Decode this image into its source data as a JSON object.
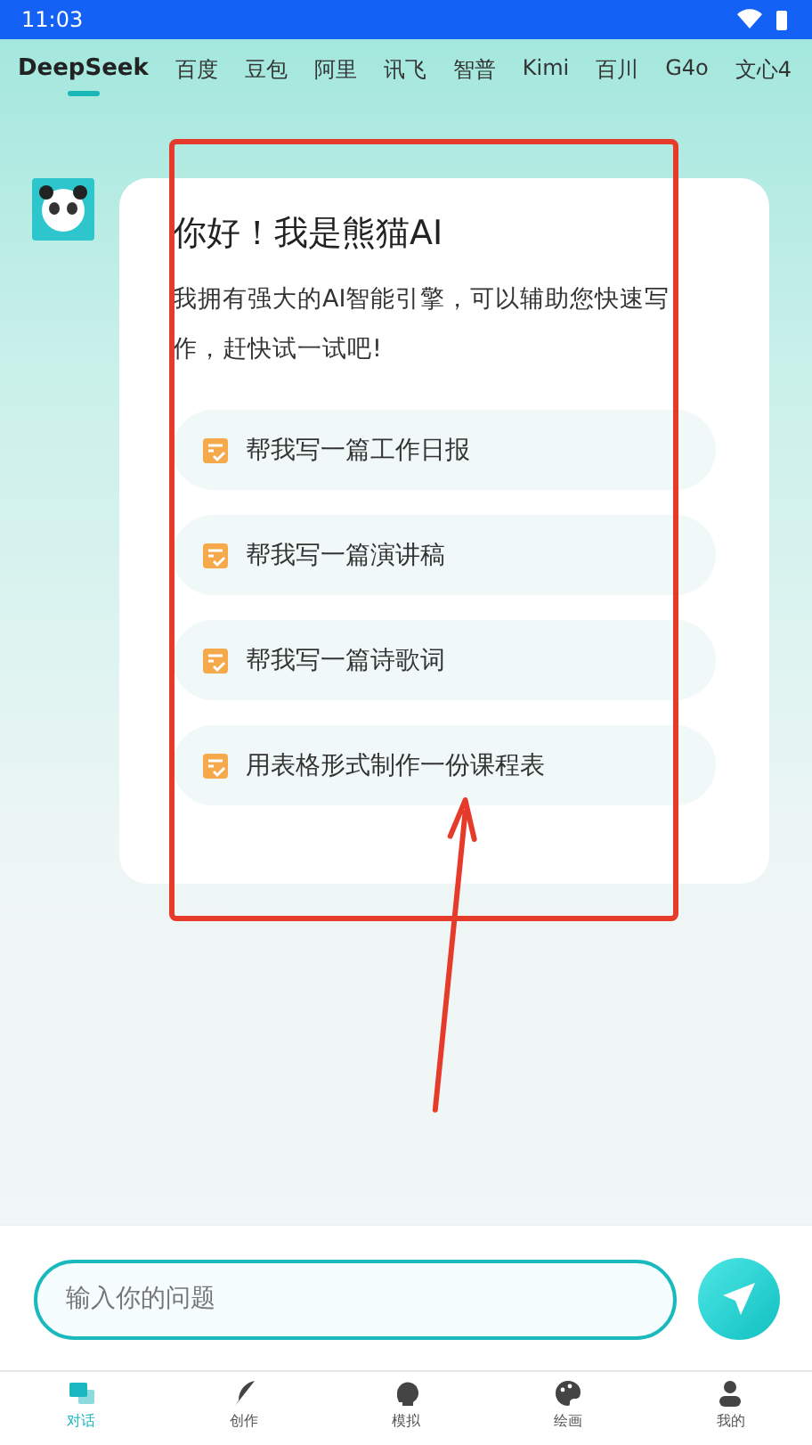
{
  "status_bar": {
    "time": "11:03"
  },
  "tabs": [
    {
      "label": "DeepSeek",
      "selected": true
    },
    {
      "label": "百度",
      "selected": false
    },
    {
      "label": "豆包",
      "selected": false
    },
    {
      "label": "阿里",
      "selected": false
    },
    {
      "label": "讯飞",
      "selected": false
    },
    {
      "label": "智普",
      "selected": false
    },
    {
      "label": "Kimi",
      "selected": false
    },
    {
      "label": "百川",
      "selected": false
    },
    {
      "label": "G4o",
      "selected": false
    },
    {
      "label": "文心4",
      "selected": false
    }
  ],
  "greeting": {
    "title": "你好！我是熊猫AI",
    "description": "我拥有强大的AI智能引擎，可以辅助您快速写作，赶快试一试吧!"
  },
  "suggestions": [
    "帮我写一篇工作日报",
    "帮我写一篇演讲稿",
    "帮我写一篇诗歌词",
    "用表格形式制作一份课程表"
  ],
  "input": {
    "placeholder": "输入你的问题"
  },
  "nav": [
    {
      "label": "对话",
      "selected": true
    },
    {
      "label": "创作",
      "selected": false
    },
    {
      "label": "模拟",
      "selected": false
    },
    {
      "label": "绘画",
      "selected": false
    },
    {
      "label": "我的",
      "selected": false
    }
  ]
}
